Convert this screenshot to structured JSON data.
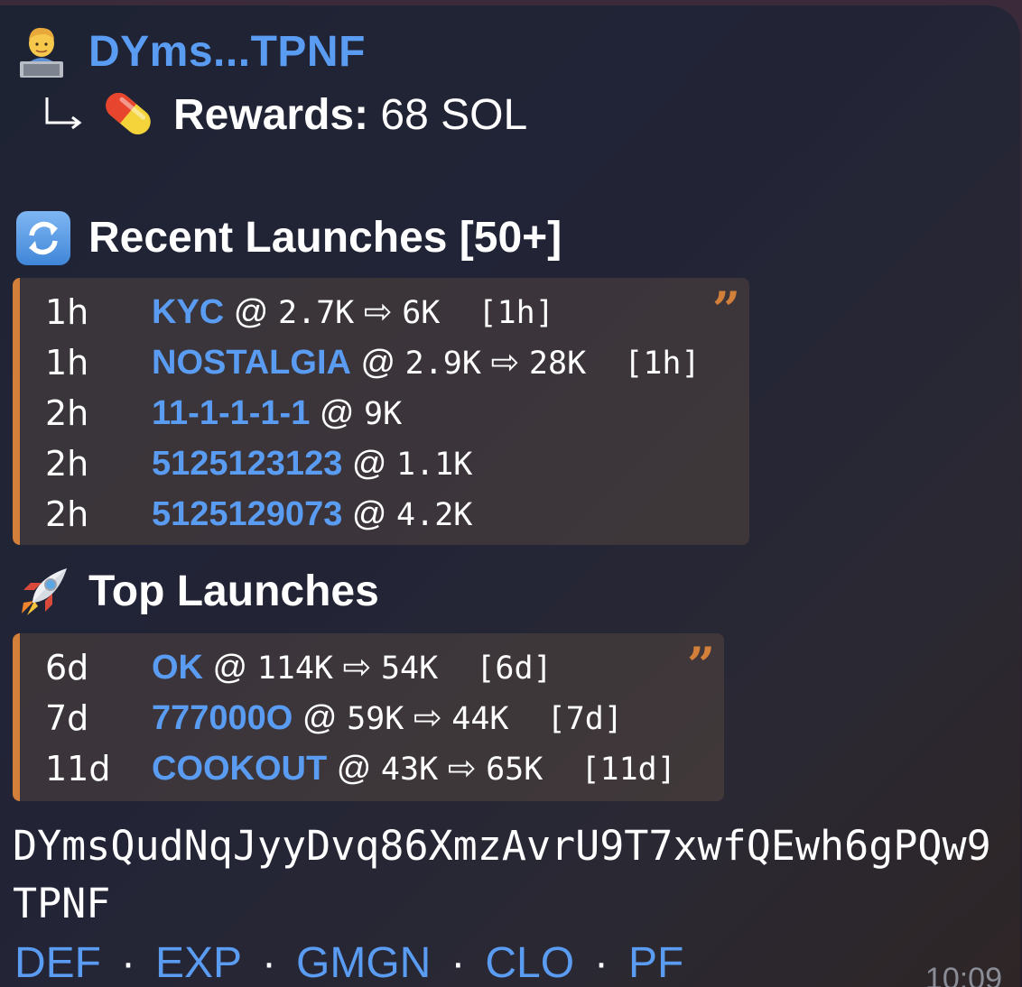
{
  "header": {
    "name": "DYms...TPNF",
    "rewards_label": "Rewards:",
    "rewards_value": " 68 SOL",
    "user_icon": "technologist-icon",
    "arrow_icon": "return-arrow-icon",
    "rewards_icon": "pill-icon"
  },
  "recent": {
    "title": "Recent Launches [50+]",
    "icon": "refresh-icon",
    "rows": [
      {
        "age": "1h",
        "name": "KYC",
        "at": " @ ",
        "mc": "2.7K",
        "arrow": " ⇨ ",
        "peak": "6K",
        "dur": "  [1h]"
      },
      {
        "age": "1h",
        "name": "NOSTALGIA",
        "at": " @ ",
        "mc": "2.9K",
        "arrow": " ⇨ ",
        "peak": "28K",
        "dur": "  [1h]"
      },
      {
        "age": "2h",
        "name": "11-1-1-1-1",
        "at": " @ ",
        "mc": "9K",
        "arrow": "",
        "peak": "",
        "dur": ""
      },
      {
        "age": "2h",
        "name": "5125123123",
        "at": " @ ",
        "mc": "1.1K",
        "arrow": "",
        "peak": "",
        "dur": ""
      },
      {
        "age": "2h",
        "name": "5125129073",
        "at": " @ ",
        "mc": "4.2K",
        "arrow": "",
        "peak": "",
        "dur": ""
      }
    ]
  },
  "top": {
    "title": "Top Launches",
    "icon": "rocket-icon",
    "rows": [
      {
        "age": "6d",
        "name": "OK",
        "at": " @ ",
        "mc": "114K",
        "arrow": " ⇨ ",
        "peak": "54K",
        "dur": "  [6d]"
      },
      {
        "age": "7d",
        "name": "777000O",
        "at": " @ ",
        "mc": "59K",
        "arrow": " ⇨ ",
        "peak": "44K",
        "dur": "  [7d]"
      },
      {
        "age": "11d",
        "name": "COOKOUT",
        "at": " @ ",
        "mc": "43K",
        "arrow": " ⇨ ",
        "peak": "65K",
        "dur": "  [11d]"
      }
    ]
  },
  "quote_mark": "”",
  "address": "DYmsQudNqJyyDvq86XmzAvrU9T7xwfQEwh6gPQw9TPNF",
  "links": [
    "DEF",
    "EXP",
    "GMGN",
    "CLO",
    "PF"
  ],
  "link_separator": "·",
  "time": "10:09",
  "colors": {
    "link": "#5a9cf2",
    "quote_accent": "#d27f3a",
    "time": "#8a8c96"
  }
}
